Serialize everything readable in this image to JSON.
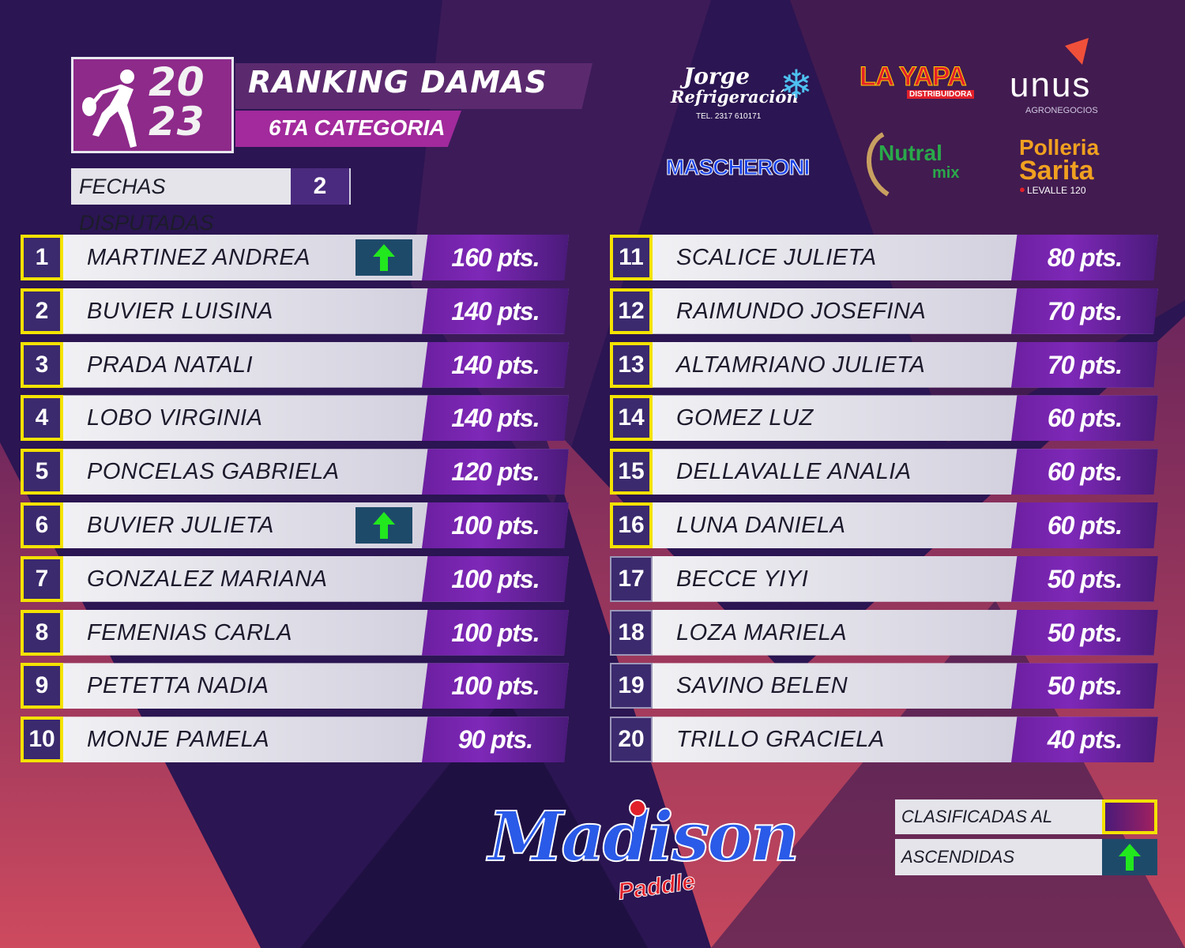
{
  "header": {
    "year_top": "20",
    "year_bottom": "23",
    "title": "RANKING DAMAS",
    "subtitle": "6TA CATEGORIA",
    "fechas_label": "FECHAS DISPUTADAS",
    "fechas_value": "2"
  },
  "sponsors": {
    "jorge_line1": "Jorge",
    "jorge_line2": "Refrigeración",
    "jorge_tel": "TEL. 2317 610171",
    "layapa_name": "LA YAPA",
    "layapa_sub": "DISTRIBUIDORA",
    "unus_name": "unus",
    "unus_sub": "AGRONEGOCIOS",
    "mascheroni": "MASCHERONI",
    "nutral_1": "Nutral",
    "nutral_2": "mix",
    "polleria_1": "Polleria",
    "polleria_2": "Sarita",
    "polleria_addr": "LEVALLE 120"
  },
  "ranking_left": [
    {
      "pos": "1",
      "name": "MARTINEZ ANDREA",
      "pts": "160 pts.",
      "master": true,
      "up": true
    },
    {
      "pos": "2",
      "name": "BUVIER LUISINA",
      "pts": "140 pts.",
      "master": true,
      "up": false
    },
    {
      "pos": "3",
      "name": "PRADA NATALI",
      "pts": "140 pts.",
      "master": true,
      "up": false
    },
    {
      "pos": "4",
      "name": "LOBO VIRGINIA",
      "pts": "140 pts.",
      "master": true,
      "up": false
    },
    {
      "pos": "5",
      "name": "PONCELAS GABRIELA",
      "pts": "120 pts.",
      "master": true,
      "up": false
    },
    {
      "pos": "6",
      "name": "BUVIER JULIETA",
      "pts": "100 pts.",
      "master": true,
      "up": true
    },
    {
      "pos": "7",
      "name": "GONZALEZ MARIANA",
      "pts": "100 pts.",
      "master": true,
      "up": false
    },
    {
      "pos": "8",
      "name": "FEMENIAS CARLA",
      "pts": "100 pts.",
      "master": true,
      "up": false
    },
    {
      "pos": "9",
      "name": "PETETTA NADIA",
      "pts": "100 pts.",
      "master": true,
      "up": false
    },
    {
      "pos": "10",
      "name": "MONJE PAMELA",
      "pts": "90 pts.",
      "master": true,
      "up": false
    }
  ],
  "ranking_right": [
    {
      "pos": "11",
      "name": "SCALICE JULIETA",
      "pts": "80 pts.",
      "master": true,
      "up": false
    },
    {
      "pos": "12",
      "name": "RAIMUNDO JOSEFINA",
      "pts": "70 pts.",
      "master": true,
      "up": false
    },
    {
      "pos": "13",
      "name": "ALTAMRIANO JULIETA",
      "pts": "70 pts.",
      "master": true,
      "up": false
    },
    {
      "pos": "14",
      "name": "GOMEZ LUZ",
      "pts": "60 pts.",
      "master": true,
      "up": false
    },
    {
      "pos": "15",
      "name": "DELLAVALLE ANALIA",
      "pts": "60 pts.",
      "master": true,
      "up": false
    },
    {
      "pos": "16",
      "name": "LUNA DANIELA",
      "pts": "60 pts.",
      "master": true,
      "up": false
    },
    {
      "pos": "17",
      "name": "BECCE YIYI",
      "pts": "50 pts.",
      "master": false,
      "up": false
    },
    {
      "pos": "18",
      "name": "LOZA MARIELA",
      "pts": "50 pts.",
      "master": false,
      "up": false
    },
    {
      "pos": "19",
      "name": "SAVINO BELEN",
      "pts": "50 pts.",
      "master": false,
      "up": false
    },
    {
      "pos": "20",
      "name": "TRILLO GRACIELA",
      "pts": "40 pts.",
      "master": false,
      "up": false
    }
  ],
  "legend": {
    "master_label": "CLASIFICADAS AL MASTER",
    "up_label": "ASCENDIDAS"
  },
  "brand": {
    "name": "Madison",
    "sub": "Paddle"
  },
  "colors": {
    "background": "#2a1550",
    "accent_pink": "#c83a5e",
    "highlight_yellow": "#f4e200",
    "points_purple": "#7e28b8",
    "arrow_green": "#22e81e"
  }
}
